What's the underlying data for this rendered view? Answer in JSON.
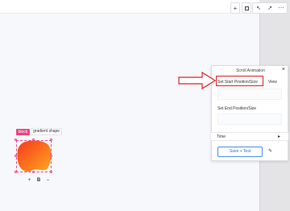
{
  "toolbar": {
    "add_icon": "plus-icon",
    "layout_icon": "layout-icon",
    "undo_icon": "undo-icon",
    "redo_icon": "redo-icon",
    "more_icon": "more-icon"
  },
  "panel": {
    "title": "Scroll Animation",
    "close_symbol": "×",
    "start_label": "Set Start Position/Size",
    "start_view": "View",
    "end_label": "Set End Position/Size",
    "end_view": "View",
    "time_label": "Time",
    "time_arrow": "▸",
    "save_label": "Save + Test",
    "pen_symbol": "✎"
  },
  "canvas": {
    "block_tag": "block",
    "element_name": "gradient shape",
    "zoom_minus": "–",
    "zoom_value": "B",
    "zoom_plus": "+"
  },
  "colors": {
    "accent_pink": "#e8467f",
    "highlight_red": "#d8262d",
    "link_blue": "#2a6fd6",
    "gradient_start": "#f73a1c",
    "gradient_end": "#ffa620"
  }
}
